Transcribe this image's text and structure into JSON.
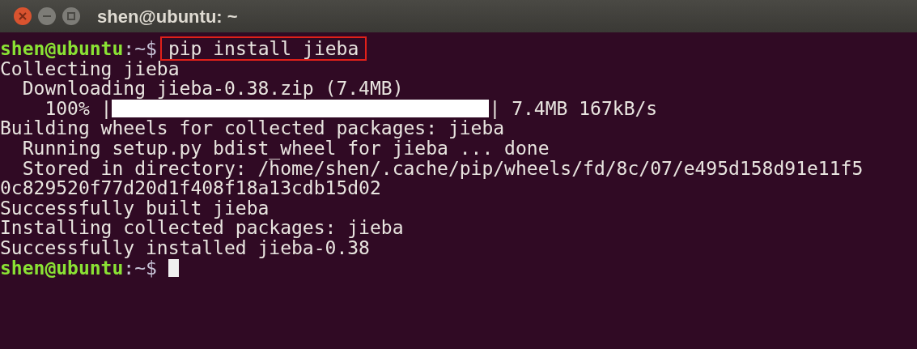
{
  "window": {
    "title": "shen@ubuntu: ~"
  },
  "lines": [
    {
      "kind": "prompt",
      "user": "shen@ubuntu",
      "path": ":~$",
      "command": "pip install jieba",
      "highlighted": true,
      "cursor": false
    },
    {
      "kind": "output",
      "text": "Collecting jieba"
    },
    {
      "kind": "output",
      "text": "  Downloading jieba-0.38.zip (7.4MB)"
    },
    {
      "kind": "progress",
      "prefix": "    100% |",
      "level": 1,
      "suffix": "| 7.4MB 167kB/s"
    },
    {
      "kind": "output",
      "text": "Building wheels for collected packages: jieba"
    },
    {
      "kind": "output",
      "text": "  Running setup.py bdist_wheel for jieba ... done"
    },
    {
      "kind": "output",
      "text": "  Stored in directory: /home/shen/.cache/pip/wheels/fd/8c/07/e495d158d91e11f5"
    },
    {
      "kind": "output",
      "text": "0c829520f77d20d1f408f18a13cdb15d02"
    },
    {
      "kind": "output",
      "text": "Successfully built jieba"
    },
    {
      "kind": "output",
      "text": "Installing collected packages: jieba"
    },
    {
      "kind": "output",
      "text": "Successfully installed jieba-0.38"
    },
    {
      "kind": "prompt",
      "user": "shen@ubuntu",
      "path": ":~$",
      "cursor": true
    }
  ]
}
